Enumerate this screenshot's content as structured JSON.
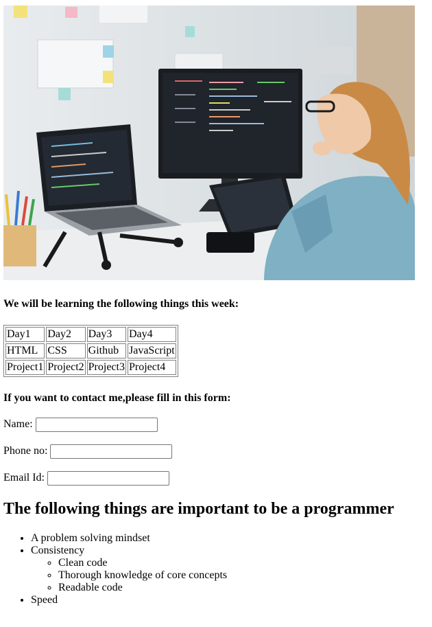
{
  "image": {
    "icon": "woman-coding-at-desk-photo"
  },
  "intro_heading": "We will be learning the following things this week:",
  "schedule": {
    "rows": [
      [
        "Day1",
        "Day2",
        "Day3",
        "Day4"
      ],
      [
        "HTML",
        "CSS",
        "Github",
        "JavaScript"
      ],
      [
        "Project1",
        "Project2",
        "Project3",
        "Project4"
      ]
    ]
  },
  "contact_heading": "If you want to contact me,please fill in this form:",
  "form": {
    "name_label": "Name:",
    "name_value": "",
    "phone_label": "Phone no:",
    "phone_value": "",
    "email_label": "Email Id:",
    "email_value": ""
  },
  "programmer_heading": "The following things are important to be a programmer",
  "list": {
    "item1": "A problem solving mindset",
    "item2": "Consistency",
    "sub": [
      "Clean code",
      "Thorough knowledge of core concepts",
      "Readable code"
    ],
    "item3": "Speed"
  }
}
